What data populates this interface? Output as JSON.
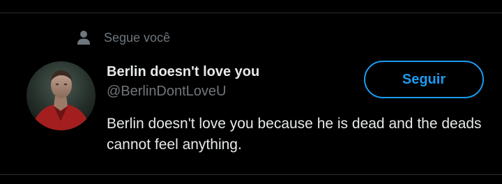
{
  "context": {
    "icon": "person-icon",
    "text": "Segue você"
  },
  "user": {
    "display_name": "Berlin doesn't love you",
    "handle": "@BerlinDontLoveU",
    "bio": "Berlin doesn't love you because he is dead and the deads cannot feel anything."
  },
  "follow_button": {
    "label": "Seguir"
  },
  "colors": {
    "background": "#000000",
    "accent": "#1d9bf0",
    "primary_text": "#e7e9ea",
    "secondary_text": "#71767b",
    "divider": "#2a2e32"
  }
}
